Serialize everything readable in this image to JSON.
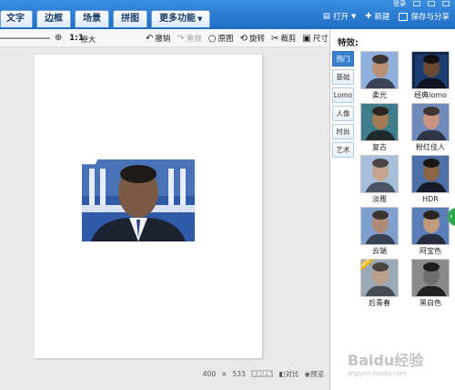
{
  "top": {
    "user": "登录",
    "min": "—",
    "close": "✕"
  },
  "tabs": [
    {
      "label": "文字"
    },
    {
      "label": "边框"
    },
    {
      "label": "场景"
    },
    {
      "label": "拼图"
    },
    {
      "label": "更多功能"
    }
  ],
  "actions": {
    "open": "打开",
    "new": "新建",
    "save": "保存与分享"
  },
  "toolbar": {
    "ratio": "1:1",
    "ratio_label": "原大",
    "undo": "撤销",
    "redo": "重做",
    "original": "原图",
    "rotate": "旋转",
    "crop": "裁剪",
    "size": "尺寸"
  },
  "status": {
    "width": "400",
    "times": "×",
    "height": "533",
    "exif": "EXIFA",
    "compare": "对比",
    "preview": "预览"
  },
  "panel": {
    "title": "特效:",
    "categories": [
      "热门",
      "基础",
      "Lomo",
      "人像",
      "时尚",
      "艺术"
    ],
    "effects": [
      {
        "label": "柔光"
      },
      {
        "label": "经典lomo"
      },
      {
        "label": "复古"
      },
      {
        "label": "粉红佳人"
      },
      {
        "label": "淡雅"
      },
      {
        "label": "HDR"
      },
      {
        "label": "云端"
      },
      {
        "label": "阿宝色"
      },
      {
        "label": "后青春"
      },
      {
        "label": "黑白色"
      }
    ]
  },
  "watermark": {
    "text": "Baidu经验",
    "sub": "jingyan.baidu.com"
  }
}
